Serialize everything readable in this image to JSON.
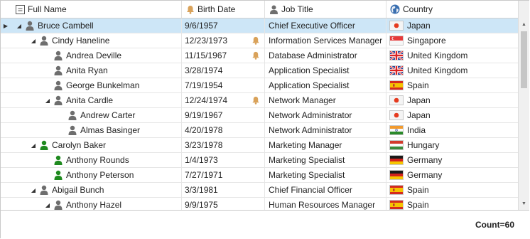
{
  "header": {
    "columns": [
      {
        "label": "Full Name",
        "icon": "column-chooser-icon"
      },
      {
        "label": "Birth Date",
        "icon": "bell-icon"
      },
      {
        "label": "Job Title",
        "icon": "person-icon"
      },
      {
        "label": "Country",
        "icon": "globe-icon"
      }
    ]
  },
  "rows": [
    {
      "name": "Bruce Cambell",
      "level": 0,
      "expanded": true,
      "current": true,
      "selected": true,
      "person_color": "#6e6e6e",
      "birth": "9/6/1957",
      "bell": false,
      "job": "Chief Executive Officer",
      "country": "Japan",
      "flag": "japan"
    },
    {
      "name": "Cindy Haneline",
      "level": 1,
      "expanded": true,
      "person_color": "#6e6e6e",
      "birth": "12/23/1973",
      "bell": true,
      "job": "Information Services Manager",
      "country": "Singapore",
      "flag": "singapore"
    },
    {
      "name": "Andrea Deville",
      "level": 2,
      "person_color": "#6e6e6e",
      "birth": "11/15/1967",
      "bell": true,
      "job": "Database Administrator",
      "country": "United Kingdom",
      "flag": "uk"
    },
    {
      "name": "Anita Ryan",
      "level": 2,
      "person_color": "#6e6e6e",
      "birth": "3/28/1974",
      "bell": false,
      "job": "Application Specialist",
      "country": "United Kingdom",
      "flag": "uk"
    },
    {
      "name": "George Bunkelman",
      "level": 2,
      "person_color": "#6e6e6e",
      "birth": "7/19/1954",
      "bell": false,
      "job": "Application Specialist",
      "country": "Spain",
      "flag": "spain"
    },
    {
      "name": "Anita Cardle",
      "level": 2,
      "expanded": true,
      "person_color": "#6e6e6e",
      "birth": "12/24/1974",
      "bell": true,
      "job": "Network Manager",
      "country": "Japan",
      "flag": "japan"
    },
    {
      "name": "Andrew Carter",
      "level": 3,
      "person_color": "#6e6e6e",
      "birth": "9/19/1967",
      "bell": false,
      "job": "Network Administrator",
      "country": "Japan",
      "flag": "japan"
    },
    {
      "name": "Almas Basinger",
      "level": 3,
      "person_color": "#6e6e6e",
      "birth": "4/20/1978",
      "bell": false,
      "job": "Network Administrator",
      "country": "India",
      "flag": "india"
    },
    {
      "name": "Carolyn Baker",
      "level": 1,
      "expanded": true,
      "person_color": "#1f8a1f",
      "birth": "3/23/1978",
      "bell": false,
      "job": "Marketing Manager",
      "country": "Hungary",
      "flag": "hungary"
    },
    {
      "name": "Anthony Rounds",
      "level": 2,
      "person_color": "#1f8a1f",
      "birth": "1/4/1973",
      "bell": false,
      "job": "Marketing Specialist",
      "country": "Germany",
      "flag": "germany"
    },
    {
      "name": "Anthony Peterson",
      "level": 2,
      "person_color": "#1f8a1f",
      "birth": "7/27/1971",
      "bell": false,
      "job": "Marketing Specialist",
      "country": "Germany",
      "flag": "germany"
    },
    {
      "name": "Abigail Bunch",
      "level": 1,
      "expanded": true,
      "person_color": "#6e6e6e",
      "birth": "3/3/1981",
      "bell": false,
      "job": "Chief Financial Officer",
      "country": "Spain",
      "flag": "spain"
    },
    {
      "name": "Anthony Hazel",
      "level": 2,
      "expanded": true,
      "person_color": "#6e6e6e",
      "birth": "9/9/1975",
      "bell": false,
      "job": "Human Resources Manager",
      "country": "Spain",
      "flag": "spain"
    }
  ],
  "footer": {
    "count_label": "Count=60"
  },
  "colors": {
    "selected_row": "#cde6f7",
    "bell": "#d9a25a",
    "manager_person": "#1f8a1f",
    "default_person": "#6e6e6e"
  }
}
